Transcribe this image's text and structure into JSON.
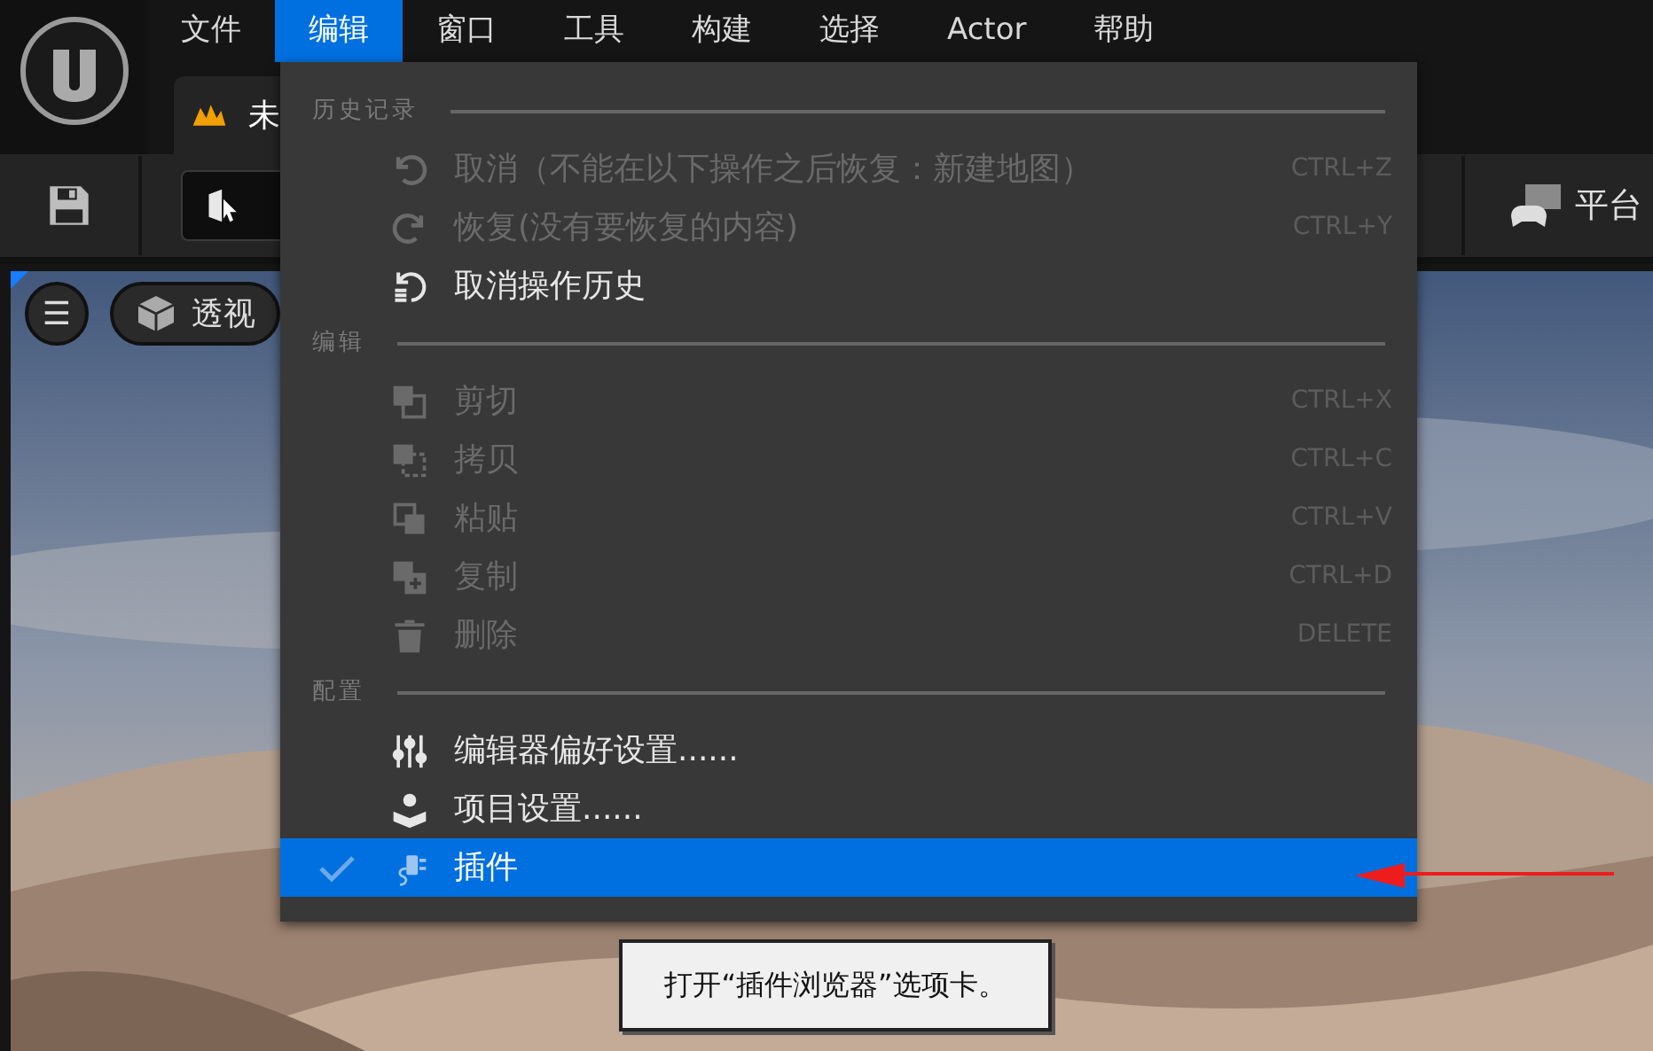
{
  "menu_bar": [
    {
      "label": "文件",
      "selected": false
    },
    {
      "label": "编辑",
      "selected": true
    },
    {
      "label": "窗口",
      "selected": false
    },
    {
      "label": "工具",
      "selected": false
    },
    {
      "label": "构建",
      "selected": false
    },
    {
      "label": "选择",
      "selected": false
    },
    {
      "label": "Actor",
      "selected": false
    },
    {
      "label": "帮助",
      "selected": false
    }
  ],
  "document_tab": {
    "label": "未"
  },
  "toolbar": {
    "platform_button": "平台"
  },
  "viewport": {
    "menu_button": "☰",
    "view_mode": "透视"
  },
  "edit_menu": {
    "sections": [
      {
        "title": "历史记录",
        "items": [
          {
            "label": "取消（不能在以下操作之后恢复：新建地图）",
            "shortcut": "CTRL+Z",
            "disabled": true,
            "selected": false
          },
          {
            "label": "恢复(没有要恢复的内容)",
            "shortcut": "CTRL+Y",
            "disabled": true,
            "selected": false
          },
          {
            "label": "取消操作历史",
            "disabled": false,
            "selected": false
          }
        ]
      },
      {
        "title": "编辑",
        "items": [
          {
            "label": "剪切",
            "shortcut": "CTRL+X",
            "disabled": true,
            "selected": false
          },
          {
            "label": "拷贝",
            "shortcut": "CTRL+C",
            "disabled": true,
            "selected": false
          },
          {
            "label": "粘贴",
            "shortcut": "CTRL+V",
            "disabled": true,
            "selected": false
          },
          {
            "label": "复制",
            "shortcut": "CTRL+D",
            "disabled": true,
            "selected": false
          },
          {
            "label": "删除",
            "shortcut": "DELETE",
            "disabled": true,
            "selected": false
          }
        ]
      },
      {
        "title": "配置",
        "items": [
          {
            "label": "编辑器偏好设置......",
            "disabled": false,
            "selected": false
          },
          {
            "label": "项目设置......",
            "disabled": false,
            "selected": false
          },
          {
            "label": "插件",
            "disabled": false,
            "selected": true
          }
        ]
      }
    ]
  },
  "tooltip": {
    "text": "打开“插件浏览器”选项卡。"
  }
}
